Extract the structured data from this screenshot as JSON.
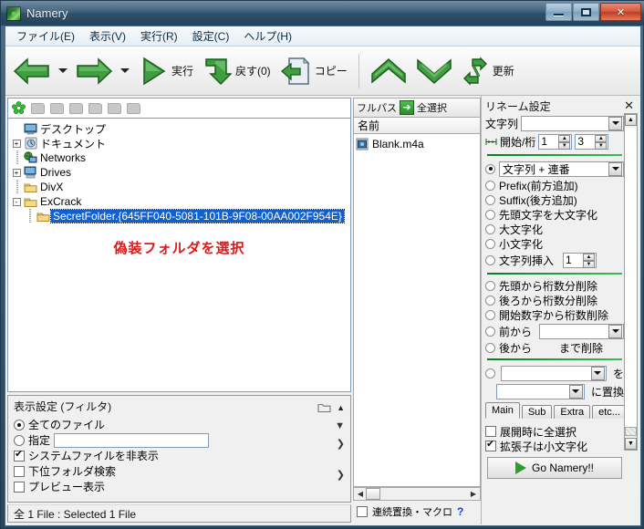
{
  "window": {
    "title": "Namery",
    "app_icon": "namery-logo-icon",
    "buttons": {
      "minimize": "minimize-icon",
      "maximize": "maximize-icon",
      "close": "close-icon"
    }
  },
  "menubar": {
    "items": [
      {
        "label": "ファイル(E)",
        "name": "menu-file"
      },
      {
        "label": "表示(V)",
        "name": "menu-view"
      },
      {
        "label": "実行(R)",
        "name": "menu-run"
      },
      {
        "label": "設定(C)",
        "name": "menu-settings"
      },
      {
        "label": "ヘルプ(H)",
        "name": "menu-help"
      }
    ]
  },
  "toolbar": {
    "back_label": "",
    "forward_label": "",
    "run_label": "実行",
    "undo_label": "戻す(0)",
    "copy_label": "コピー",
    "up_label": "",
    "down_label": "",
    "refresh_label": "更新"
  },
  "tree": {
    "favorites_count": 6,
    "nodes": [
      {
        "label": "デスクトップ",
        "indent": 0,
        "expander": "",
        "icon": "desktop-icon",
        "selected": false
      },
      {
        "label": "ドキュメント",
        "indent": 1,
        "expander": "+",
        "icon": "documents-icon",
        "selected": false
      },
      {
        "label": "Networks",
        "indent": 1,
        "expander": "",
        "icon": "network-icon",
        "selected": false
      },
      {
        "label": "Drives",
        "indent": 1,
        "expander": "+",
        "icon": "drives-icon",
        "selected": false
      },
      {
        "label": "DivX",
        "indent": 1,
        "expander": "",
        "icon": "folder-icon",
        "selected": false
      },
      {
        "label": "ExCrack",
        "indent": 1,
        "expander": "-",
        "icon": "folder-icon",
        "selected": false
      },
      {
        "label": "SecretFolder.{645FF040-5081-101B-9F08-00AA002F954E}",
        "indent": 2,
        "expander": "",
        "icon": "folder-icon",
        "selected": true
      }
    ],
    "annotation": "偽装フォルダを選択"
  },
  "display_settings": {
    "title": "表示設定 (フィルタ)",
    "all_files": {
      "label": "全てのファイル",
      "checked": true
    },
    "specify": {
      "label": "指定",
      "checked": false,
      "value": "",
      "placeholder": ""
    },
    "hide_system": {
      "label": "システムファイルを非表示",
      "checked": true
    },
    "search_sub": {
      "label": "下位フォルダ検索",
      "checked": false
    },
    "preview": {
      "label": "プレビュー表示",
      "checked": false
    },
    "folder_icon": "folder-icon",
    "collapse_icon": "chevron-up-icon",
    "expand_icon": "chevron-down-icon",
    "more_icon": "chevron-right-icon"
  },
  "statusbar": {
    "text": "全 1 File : Selected 1 File"
  },
  "filelist": {
    "fullpath_label": "フルパス",
    "go_icon": "green-arrow-right-icon",
    "select_all_label": "全選択",
    "column_header": "名前",
    "rows": [
      {
        "name": "Blank.m4a",
        "icon": "media-file-icon"
      }
    ],
    "macro_label": "連続置換・マクロ",
    "macro_checked": false,
    "help_label": "?"
  },
  "rename": {
    "title": "リネーム設定",
    "close_label": "✕",
    "string_label": "文字列",
    "string_value": "",
    "start_digits_label": "開始/桁",
    "start_value": "1",
    "digits_value": "3",
    "mode_selected": "文字列 + 連番",
    "modes": [
      {
        "label": "文字列 + 連番",
        "selected": true,
        "is_combo": true
      },
      {
        "label": "Prefix(前方追加)",
        "selected": false
      },
      {
        "label": "Suffix(後方追加)",
        "selected": false
      },
      {
        "label": "先頭文字を大文字化",
        "selected": false
      },
      {
        "label": "大文字化",
        "selected": false
      },
      {
        "label": "小文字化",
        "selected": false
      },
      {
        "label": "文字列挿入",
        "selected": false,
        "spin": "1"
      }
    ],
    "delete_options": [
      {
        "label": "先頭から桁数分削除",
        "selected": false
      },
      {
        "label": "後ろから桁数分削除",
        "selected": false
      },
      {
        "label": "開始数字から桁数削除",
        "selected": false
      },
      {
        "label": "前から",
        "selected": false,
        "combo": ""
      },
      {
        "label": "後から",
        "selected": false,
        "suffix": "まで削除"
      }
    ],
    "replace": {
      "selected": false,
      "from_value": "",
      "to_value": "",
      "wo_label": "を",
      "ni_label": "に置換"
    },
    "tabs": [
      {
        "label": "Main",
        "active": true
      },
      {
        "label": "Sub",
        "active": false
      },
      {
        "label": "Extra",
        "active": false
      },
      {
        "label": "etc...",
        "active": false
      }
    ],
    "expand_select_all": {
      "label": "展開時に全選択",
      "checked": false
    },
    "ext_lowercase": {
      "label": "拡張子は小文字化",
      "checked": true
    },
    "go_button": "Go Namery!!"
  },
  "colors": {
    "title_bar": "#2e4f69",
    "selection": "#1060d0",
    "annotation_red": "#e11818",
    "green_accent": "#2f9b2f",
    "close_button": "#bf3c22"
  }
}
